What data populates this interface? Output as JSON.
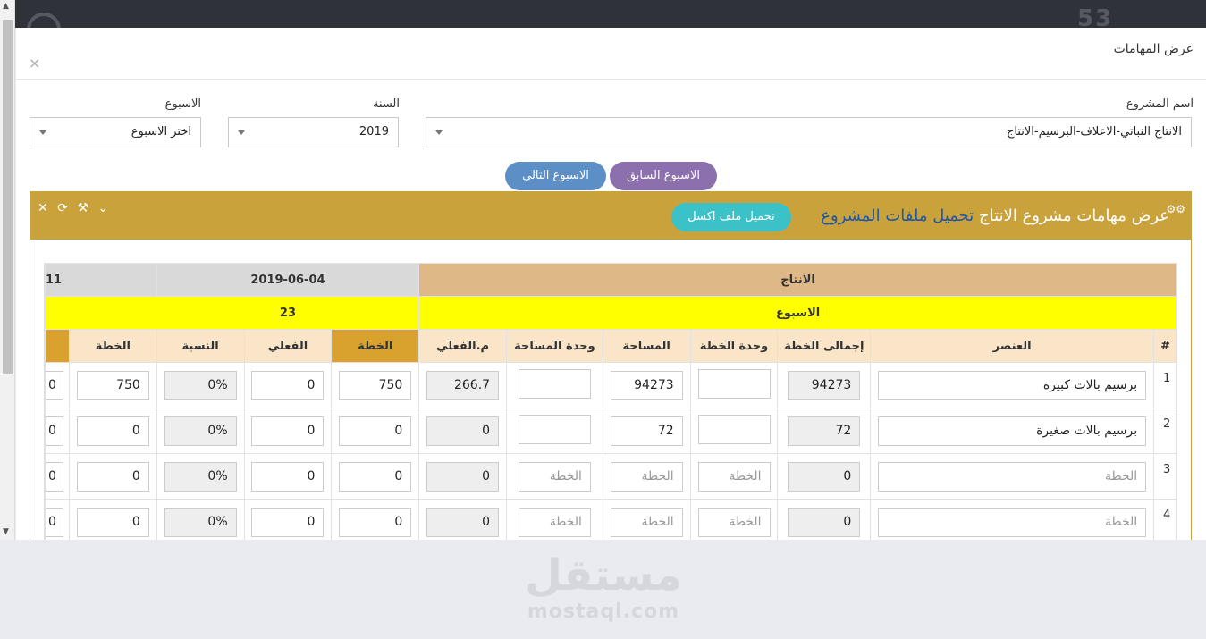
{
  "background": {
    "topbar_logo_text": "53"
  },
  "modal": {
    "title": "عرض المهامات",
    "close_icon": "×"
  },
  "filters": {
    "project_label": "اسم المشروع",
    "project_value": "الانتاج النباتي-الاعلاف-البرسيم-الانتاج",
    "year_label": "السنة",
    "year_value": "2019",
    "week_label": "الاسبوع",
    "week_value": "اختر الاسبوع"
  },
  "nav": {
    "prev_week": "الاسبوع السابق",
    "next_week": "الاسبوع التالي"
  },
  "panel": {
    "title": "عرض مهامات مشروع الانتاج",
    "files_link": "تحميل ملفات المشروع",
    "excel_button": "تحميل ملف اكسل"
  },
  "grid": {
    "group_production": "الانتاج",
    "group_date": "2019-06-04",
    "group_next_fragment": "11",
    "week_label": "الاسبوع",
    "week_number": "23",
    "columns": {
      "num": "#",
      "item": "العنصر",
      "total_plan": "إجمالى الخطة",
      "plan_unit": "وحدة الخطة",
      "area": "المساحة",
      "area_unit": "وحدة المساحة",
      "actual_area": "م.الفعلي",
      "week_plan": "الخطة",
      "week_actual": "الفعلي",
      "week_ratio": "النسبة",
      "next_plan": "الخطة"
    },
    "placeholder": "الخطة",
    "rows": [
      {
        "num": "1",
        "item": "برسيم بالات كبيرة",
        "total_plan": "94273",
        "plan_unit": "",
        "area": "94273",
        "area_unit": "",
        "actual_area": "266.7",
        "week_plan": "750",
        "week_actual": "0",
        "week_ratio": "0%",
        "next_plan": "750",
        "edge": "0"
      },
      {
        "num": "2",
        "item": "برسيم بالات صغيرة",
        "total_plan": "72",
        "plan_unit": "",
        "area": "72",
        "area_unit": "",
        "actual_area": "0",
        "week_plan": "0",
        "week_actual": "0",
        "week_ratio": "0%",
        "next_plan": "0",
        "edge": "0"
      },
      {
        "num": "3",
        "item": "",
        "total_plan": "0",
        "plan_unit": "",
        "area": "",
        "area_unit": "",
        "actual_area": "0",
        "week_plan": "0",
        "week_actual": "0",
        "week_ratio": "0%",
        "next_plan": "0",
        "edge": "0"
      },
      {
        "num": "4",
        "item": "",
        "total_plan": "0",
        "plan_unit": "",
        "area": "",
        "area_unit": "",
        "actual_area": "0",
        "week_plan": "0",
        "week_actual": "0",
        "week_ratio": "0%",
        "next_plan": "0",
        "edge": "0"
      }
    ]
  },
  "watermark": {
    "arabic": "مستقل",
    "latin": "mostaql.com"
  },
  "colors": {
    "panel": "#c9a23c",
    "prev_button": "#8c6fad",
    "next_button": "#5b8fc6",
    "excel_button": "#3bc2c9",
    "week_row": "#ffff00"
  }
}
